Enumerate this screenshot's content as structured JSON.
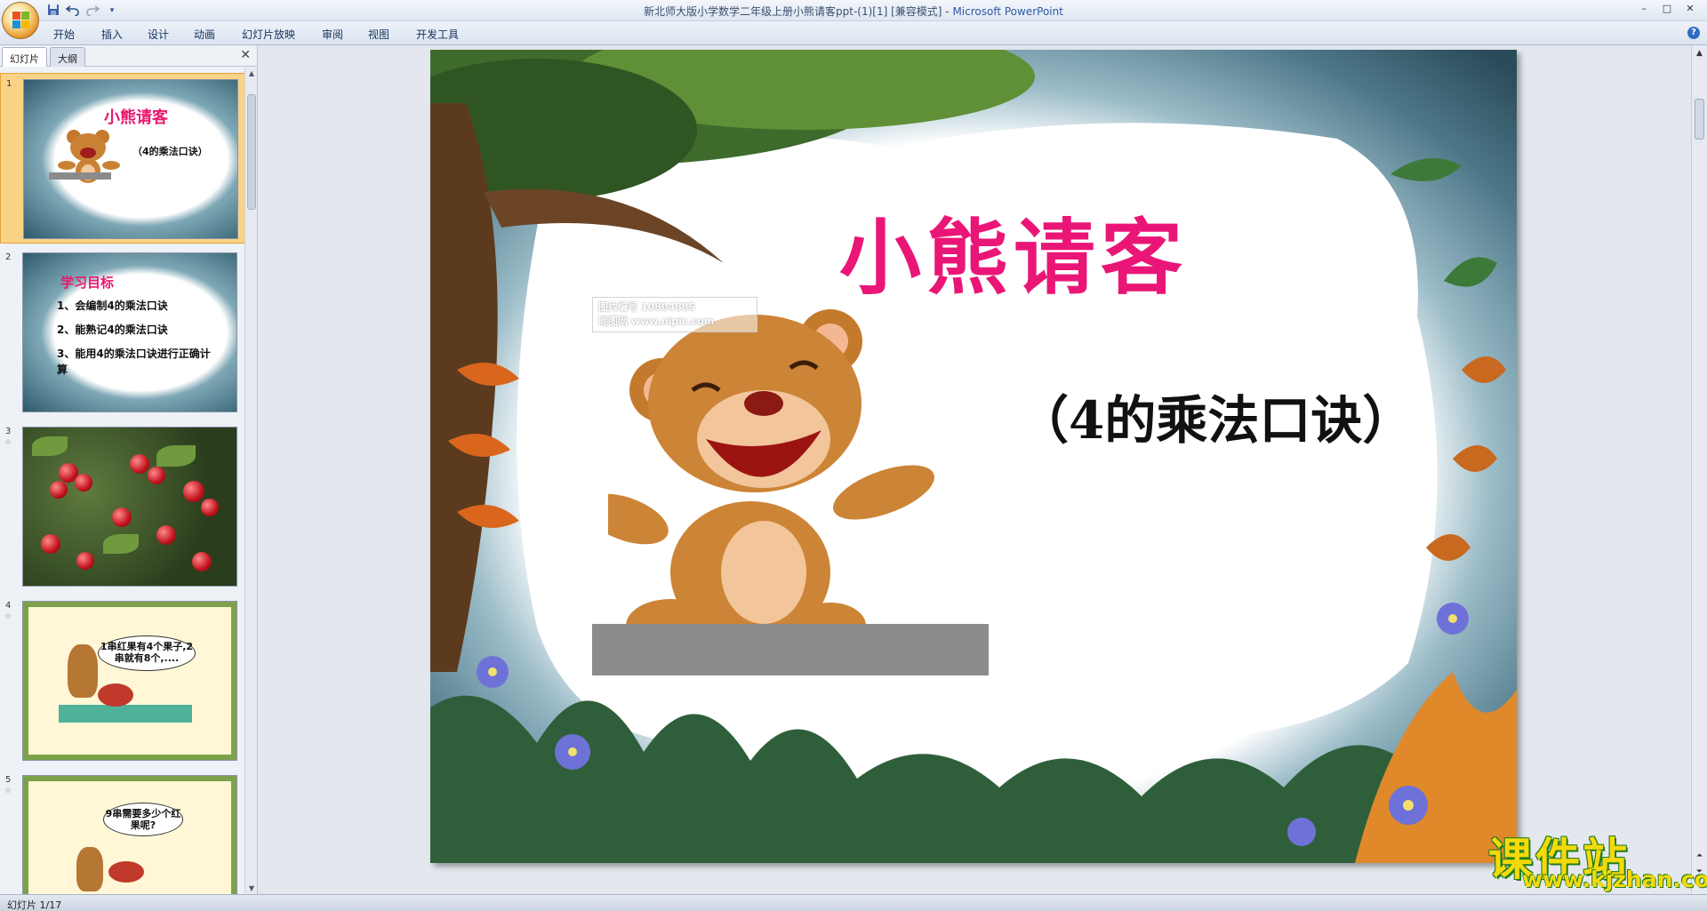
{
  "window": {
    "title": "新北师大版小学数学二年级上册小熊请客ppt-(1)[1] [兼容模式]",
    "separator": " - ",
    "app_name": "Microsoft PowerPoint",
    "minimize": "–",
    "maximize": "□",
    "close": "✕"
  },
  "qat": {
    "save_icon": "floppy-disk-icon",
    "undo_icon": "undo-icon",
    "redo_icon": "redo-icon",
    "more_icon": "dropdown-icon"
  },
  "ribbon": {
    "tabs": [
      "开始",
      "插入",
      "设计",
      "动画",
      "幻灯片放映",
      "审阅",
      "视图",
      "开发工具"
    ],
    "help": "?"
  },
  "panel": {
    "tabs": [
      "幻灯片",
      "大纲"
    ],
    "close": "✕"
  },
  "slides": [
    {
      "number": "1",
      "title": "小熊请客",
      "subtitle": "（4的乘法口诀）"
    },
    {
      "number": "2",
      "title": "学习目标",
      "lines": [
        "1、会编制4的乘法口诀",
        "2、能熟记4的乘法口诀",
        "3、能用4的乘法口诀进行正确计算"
      ]
    },
    {
      "number": "3"
    },
    {
      "number": "4",
      "bubble": "1串红果有4个果子,2串就有8个,...."
    },
    {
      "number": "5",
      "bubble": "9串需要多少个红果呢?"
    }
  ],
  "main_slide": {
    "title": "小熊请客",
    "subtitle": "（4的乘法口诀）",
    "watermark_line1": "图片编号 10804885",
    "watermark_line2": "昵图网 www.nipic.com"
  },
  "brand": {
    "name": "课件站",
    "url": "www.kjzhan.com"
  },
  "status": {
    "slide_info": "幻灯片 1/17"
  },
  "colors": {
    "title_pink": "#ea1677",
    "accent_orange": "#fbd386",
    "brand_yellow": "#f5d90a"
  }
}
